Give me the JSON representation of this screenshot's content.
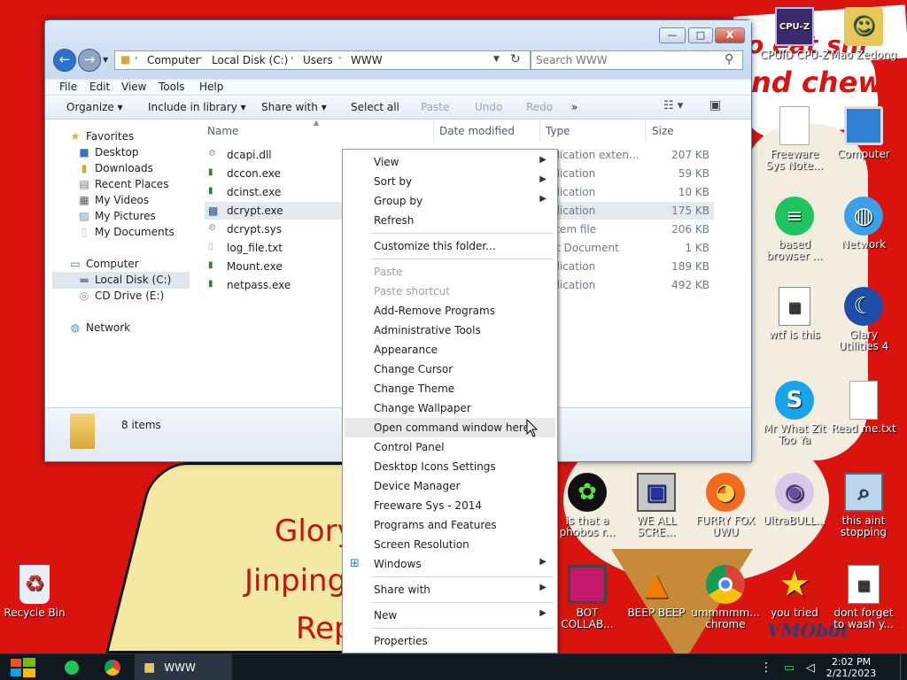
{
  "wallpaper": {
    "text_chew": "nd chew",
    "text_shi": "o eat shi",
    "text_glory": "Glory",
    "text_jinping": "Jinping",
    "text_rep": "Rep",
    "signature": "VMOb0t"
  },
  "window": {
    "minimize": "—",
    "maximize": "□",
    "close": "X",
    "back": "←",
    "forward": "→",
    "breadcrumb": [
      "Computer",
      "Local Disk (C:)",
      "Users",
      "WWW"
    ],
    "search_placeholder": "Search WWW",
    "menu": [
      "File",
      "Edit",
      "View",
      "Tools",
      "Help"
    ],
    "commands": {
      "organize": "Organize ▾",
      "include": "Include in library ▾",
      "share": "Share with ▾",
      "select_all": "Select all",
      "paste": "Paste",
      "undo": "Undo",
      "redo": "Redo",
      "more": "»"
    },
    "nav": {
      "favorites": "Favorites",
      "desktop": "Desktop",
      "downloads": "Downloads",
      "recent": "Recent Places",
      "videos": "My Videos",
      "pictures": "My Pictures",
      "documents": "My Documents",
      "computer": "Computer",
      "local_disk": "Local Disk (C:)",
      "cd_drive": "CD Drive (E:)",
      "network": "Network"
    },
    "columns": {
      "name": "Name",
      "date": "Date modified",
      "type": "Type",
      "size": "Size"
    },
    "files": [
      {
        "name": "dcapi.dll",
        "type": "plication exten...",
        "size": "207 KB"
      },
      {
        "name": "dccon.exe",
        "type": "plication",
        "size": "59 KB"
      },
      {
        "name": "dcinst.exe",
        "type": "plication",
        "size": "10 KB"
      },
      {
        "name": "dcrypt.exe",
        "type": "plication",
        "size": "175 KB"
      },
      {
        "name": "dcrypt.sys",
        "type": "stem file",
        "size": "206 KB"
      },
      {
        "name": "log_file.txt",
        "type": "xt Document",
        "size": "1 KB"
      },
      {
        "name": "Mount.exe",
        "type": "plication",
        "size": "189 KB"
      },
      {
        "name": "netpass.exe",
        "type": "plication",
        "size": "492 KB"
      }
    ],
    "item_count": "8 items"
  },
  "context_menu": {
    "view": "View",
    "sort_by": "Sort by",
    "group_by": "Group by",
    "refresh": "Refresh",
    "customize": "Customize this folder...",
    "paste": "Paste",
    "paste_shortcut": "Paste shortcut",
    "add_remove": "Add-Remove Programs",
    "admin_tools": "Administrative Tools",
    "appearance": "Appearance",
    "change_cursor": "Change Cursor",
    "change_theme": "Change Theme",
    "change_wallpaper": "Change Wallpaper",
    "open_cmd": "Open command window here",
    "control_panel": "Control Panel",
    "desktop_icons": "Desktop Icons Settings",
    "device_manager": "Device Manager",
    "freeware": "Freeware Sys - 2014",
    "programs": "Programs and Features",
    "screen_res": "Screen Resolution",
    "windows": "Windows",
    "share_with": "Share with",
    "new": "New",
    "properties": "Properties"
  },
  "desktop_icons": {
    "cpuz": "CPUID CPU-Z",
    "cpuz_badge": "CPU-Z",
    "mao": "Mao Zedong",
    "freeware": "Freeware Sys Note...",
    "computer": "Computer",
    "based": "based browser ...",
    "network": "Network",
    "wtf": "wtf is this",
    "glary": "Glary Utilities 4",
    "mrwhat": "Mr What Zit Too Ya",
    "readme": "Read me.txt",
    "phobos": "is that a phobos r...",
    "weall": "WE ALL SCRE...",
    "furry": "FURRY FOX UWU",
    "ultra": "UltraBULL...",
    "thisaint": "this aint stopping di...",
    "recycle": "Recycle Bin",
    "botcollab": "BOT COLLAB...",
    "beep": "BEEP BEEP",
    "ummm": "ummmmm... chrome",
    "youtried": "you tried",
    "dontforget": "dont forget to wash y..."
  },
  "taskbar": {
    "explorer_label": "WWW",
    "time": "2:02 PM",
    "date": "2/21/2023"
  }
}
